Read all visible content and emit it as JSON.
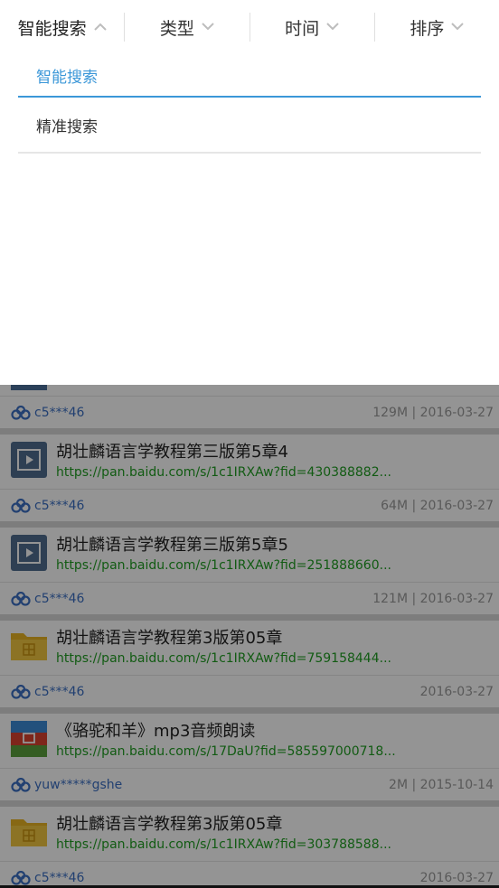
{
  "filters": [
    {
      "label": "智能搜索",
      "active": true,
      "icon": "chevron-up-icon"
    },
    {
      "label": "类型",
      "active": false,
      "icon": "chevron-down-icon"
    },
    {
      "label": "时间",
      "active": false,
      "icon": "chevron-down-icon"
    },
    {
      "label": "排序",
      "active": false,
      "icon": "chevron-down-icon"
    }
  ],
  "dropdown": {
    "options": [
      {
        "label": "智能搜索",
        "selected": true
      },
      {
        "label": "精准搜索",
        "selected": false
      }
    ]
  },
  "colors": {
    "accent": "#3b97d8",
    "url_green": "#1f9d21",
    "user_blue": "#3b6fc2"
  },
  "list": {
    "partial_item": {
      "user": "c5***46",
      "info": "129M | 2016-03-27"
    },
    "items": [
      {
        "icon": "video-file-icon",
        "title": "胡壮麟语言学教程第三版第5章4",
        "url": "https://pan.baidu.com/s/1c1IRXAw?fid=430388882...",
        "user": "c5***46",
        "info": "64M | 2016-03-27"
      },
      {
        "icon": "video-file-icon",
        "title": "胡壮麟语言学教程第三版第5章5",
        "url": "https://pan.baidu.com/s/1c1IRXAw?fid=251888660...",
        "user": "c5***46",
        "info": "121M | 2016-03-27"
      },
      {
        "icon": "folder-icon",
        "title": "胡壮麟语言学教程第3版第05章",
        "url": "https://pan.baidu.com/s/1c1IRXAw?fid=759158444...",
        "user": "c5***46",
        "info": "2016-03-27"
      },
      {
        "icon": "archive-file-icon",
        "title": "《骆驼和羊》mp3音频朗读",
        "url": "https://pan.baidu.com/s/17DaU?fid=585597000718...",
        "user": "yuw*****gshe",
        "info": "2M | 2015-10-14"
      },
      {
        "icon": "folder-icon",
        "title": "胡壮麟语言学教程第3版第05章",
        "url": "https://pan.baidu.com/s/1c1IRXAw?fid=303788588...",
        "user": "c5***46",
        "info": "2016-03-27"
      }
    ]
  }
}
